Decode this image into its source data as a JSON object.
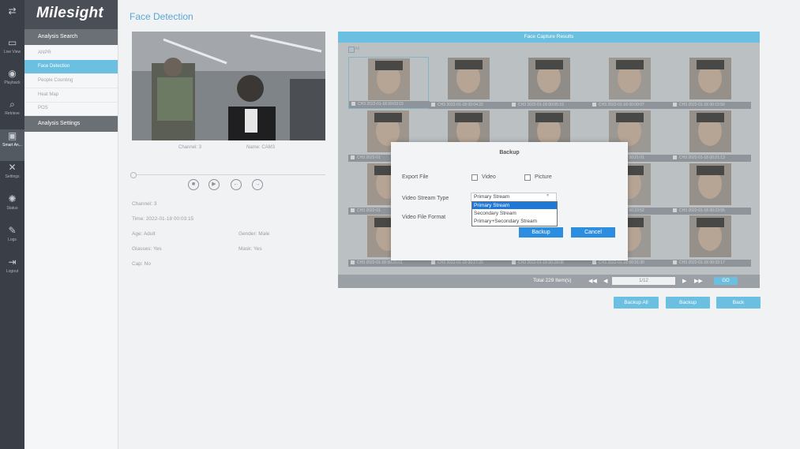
{
  "brand": {
    "logo": "Milesight"
  },
  "nav": [
    {
      "label": "",
      "icon": "arrows-swap-icon"
    },
    {
      "label": "Live View",
      "icon": "camera-icon"
    },
    {
      "label": "Playback",
      "icon": "playback-icon"
    },
    {
      "label": "Retrieve",
      "icon": "retrieve-icon"
    },
    {
      "label": "Smart An...",
      "icon": "smart-analysis-icon"
    },
    {
      "label": "Settings",
      "icon": "settings-icon"
    },
    {
      "label": "Status",
      "icon": "status-icon"
    },
    {
      "label": "Logs",
      "icon": "logs-icon"
    },
    {
      "label": "Logout",
      "icon": "logout-icon"
    }
  ],
  "menu": {
    "section1": "Analysis Search",
    "items": [
      "ANPR",
      "Face Detection",
      "People Counting",
      "Heat Map",
      "POS"
    ],
    "section2": "Analysis Settings"
  },
  "page": {
    "title": "Face Detection"
  },
  "video": {
    "channel_label": "Channel: 3",
    "name_label": "Name: CAM3",
    "playback_controls": [
      "stop-icon",
      "play-icon",
      "previous-icon",
      "next-icon"
    ]
  },
  "details": {
    "channel": "Channel: 3",
    "time": "Time: 2022-01-18 00:03:15",
    "age": "Age: Adult",
    "gender": "Gender: Male",
    "glasses": "Glasses: Yes",
    "mask": "Mask: Yes",
    "cap": "Cap: No"
  },
  "results": {
    "header": "Face Capture Results",
    "all_label": "All",
    "captures": [
      "CH3 2022-01-18 00:03:15",
      "CH3 2022-01-18 00:04:22",
      "CH3 2022-01-18 00:05:10",
      "CH3 2022-01-18 00:09:07",
      "CH3 2022-01-18 00:15:50",
      "CH3 2022-01",
      "",
      "",
      "CH3 2022-01-18 00:21:01",
      "CH3 2022-01-18 00:21:13",
      "CH3 2022-01",
      "",
      "",
      "CH3 2022-01-18 00:23:52",
      "CH3 2022-01-18 00:23:55",
      "CH3 2022-01-18 00:26:01",
      "CH3 2022-01-18 00:27:20",
      "CH3 2022-01-18 00:28:08",
      "CH3 2022-01-18 00:31:30",
      "CH3 2022-01-18 00:32:17"
    ],
    "total": "Total 229 Item(s)",
    "page_box": "1/12",
    "go": "GO"
  },
  "actions": {
    "backup_all": "Backup All",
    "backup": "Backup",
    "back": "Back"
  },
  "dialog": {
    "title": "Backup",
    "export_label": "Export File",
    "video_label": "Video",
    "picture_label": "Picture",
    "stream_label": "Video Stream Type",
    "stream_value": "Primary Stream",
    "stream_options": [
      "Primary Stream",
      "Secondary Stream",
      "Primary+Secondary Stream"
    ],
    "format_label": "Video File Format",
    "backup_btn": "Backup",
    "cancel_btn": "Cancel"
  },
  "colors": {
    "accent": "#6bbfe0",
    "sidebar": "#3a3f47",
    "dialog_button": "#2d8ee0"
  }
}
